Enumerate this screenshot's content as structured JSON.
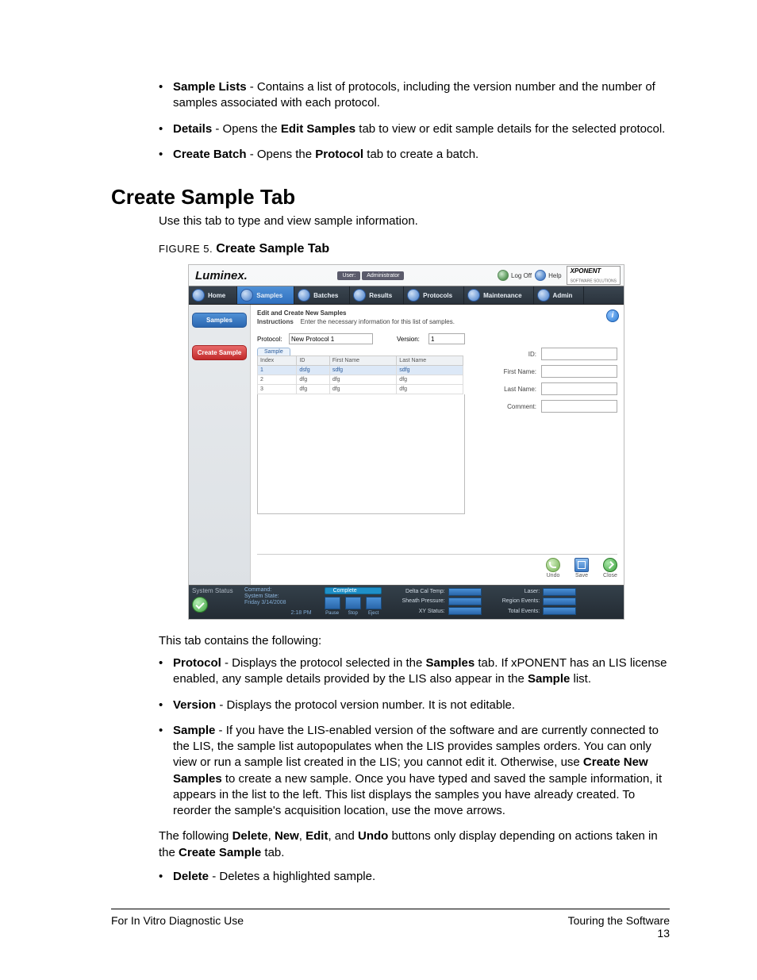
{
  "bullets_top": [
    {
      "term": "Sample Lists",
      "rest": " - Contains a list of protocols, including the version number and the number of samples associated with each protocol."
    },
    {
      "term": "Details",
      "rest": " - Opens the ",
      "b2": "Edit Samples",
      "rest2": " tab to view or edit sample details for the selected protocol."
    },
    {
      "term": "Create Batch",
      "rest": " - Opens the ",
      "b2": "Protocol",
      "rest2": " tab to create a batch."
    }
  ],
  "heading": "Create Sample Tab",
  "intro": "Use this tab to type and view sample information.",
  "figure": {
    "num": "FIGURE 5.",
    "title": "Create Sample Tab"
  },
  "shot": {
    "brand": "Luminex.",
    "userLabel": "User:",
    "userValue": "Administrator",
    "logoff": "Log Off",
    "help": "Help",
    "product": "XPONENT",
    "productSub": "SOFTWARE SOLUTIONS",
    "nav": [
      "Home",
      "Samples",
      "Batches",
      "Results",
      "Protocols",
      "Maintenance",
      "Admin"
    ],
    "navActive": 1,
    "side": [
      {
        "label": "Samples",
        "cls": ""
      },
      {
        "label": "Create Sample",
        "cls": "red"
      }
    ],
    "panelTitle": "Edit and Create New Samples",
    "instrLabel": "Instructions",
    "instrText": "Enter the necessary information for this list of samples.",
    "protocolLabel": "Protocol:",
    "protocolValue": "New Protocol 1",
    "versionLabel": "Version:",
    "versionValue": "1",
    "gridTab": "Sample",
    "gridCols": [
      "Index",
      "ID",
      "First Name",
      "Last Name"
    ],
    "gridRows": [
      {
        "sel": true,
        "cells": [
          "1",
          "dsfg",
          "sdfg",
          "sdfg"
        ]
      },
      {
        "sel": false,
        "cells": [
          "2",
          "dfg",
          "dfg",
          "dfg"
        ]
      },
      {
        "sel": false,
        "cells": [
          "3",
          "dfg",
          "dfg",
          "dfg"
        ]
      }
    ],
    "form": [
      {
        "label": "ID:",
        "val": ""
      },
      {
        "label": "First Name:",
        "val": ""
      },
      {
        "label": "Last Name:",
        "val": ""
      },
      {
        "label": "Comment:",
        "val": ""
      }
    ],
    "actions": [
      {
        "name": "Undo",
        "cls": "undo"
      },
      {
        "name": "Save",
        "cls": "save"
      },
      {
        "name": "Close",
        "cls": "close"
      }
    ],
    "status": {
      "sys": "System Status",
      "cmdLabel": "Command:",
      "stateLabel": "System State:",
      "date": "Friday 3/14/2008",
      "time": "2:18 PM",
      "complete": "Complete",
      "ctlLabels": [
        "Pause",
        "Stop",
        "Eject"
      ],
      "metricsL": [
        "Delta Cal Temp:",
        "Sheath Pressure:",
        "XY Status:"
      ],
      "metricsR": [
        "Laser:",
        "Region Events:",
        "Total Events:"
      ]
    }
  },
  "afterfig": "This tab contains the following:",
  "bullets_mid": [
    {
      "html": "<b>Protocol</b> - Displays the protocol selected in the <b>Samples</b> tab. If xPONENT has an LIS license enabled, any sample details provided by the LIS also appear in the <b>Sample</b> list."
    },
    {
      "html": "<b>Version</b> - Displays the protocol version number. It is not editable."
    },
    {
      "html": "<b>Sample</b> - If you have the LIS-enabled version of the software and are currently connected to the LIS, the sample list autopopulates when the LIS provides samples orders. You can only view or run a sample list created in the LIS; you cannot edit it. Otherwise, use <b>Create New Samples</b> to create a new sample. Once you have typed and saved the sample information, it appears in the list to the left. This list displays the samples you have already created. To reorder the sample's acquisition location, use the move arrows."
    }
  ],
  "para": "The following <b>Delete</b>, <b>New</b>, <b>Edit</b>, and <b>Undo</b> buttons only display depending on actions taken in the <b>Create Sample</b> tab.",
  "bullets_bot": [
    {
      "html": "<b>Delete</b> - Deletes a highlighted sample."
    }
  ],
  "footer": {
    "left": "For In Vitro Diagnostic Use",
    "rightTitle": "Touring the Software",
    "rightPage": "13"
  }
}
